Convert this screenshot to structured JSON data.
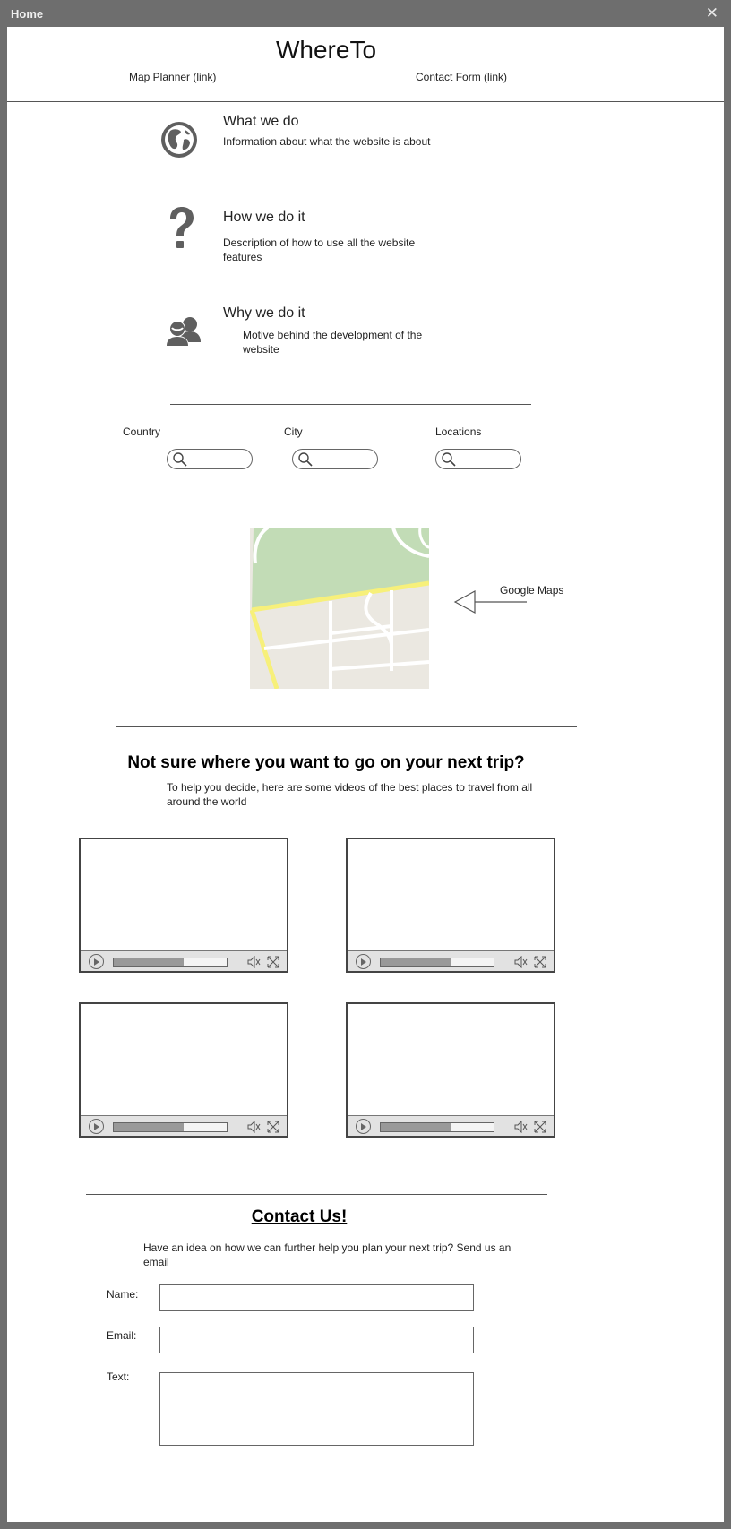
{
  "window": {
    "title": "Home",
    "close_glyph": "✕"
  },
  "header": {
    "brand": "WhereTo",
    "nav": [
      {
        "label": "Map Planner (link)"
      },
      {
        "label": "Contact Form (link)"
      }
    ]
  },
  "info": [
    {
      "icon": "globe-icon",
      "title": "What we do",
      "description": "Information about what the website is about"
    },
    {
      "icon": "question-icon",
      "title": "How we do it",
      "description": "Description of how to use all the website features"
    },
    {
      "icon": "people-icon",
      "title": "Why we do it",
      "description": "Motive behind the development of the website"
    }
  ],
  "filters": [
    {
      "label": "Country"
    },
    {
      "label": "City"
    },
    {
      "label": "Locations"
    }
  ],
  "map": {
    "label": "Google Maps"
  },
  "videos_section": {
    "heading": "Not sure where you want to go on your next trip?",
    "description": "To help you decide, here are some  videos of the best places to travel from all around the world",
    "videos": [
      {
        "progress": 0.62
      },
      {
        "progress": 0.62
      },
      {
        "progress": 0.62
      },
      {
        "progress": 0.62
      }
    ]
  },
  "contact": {
    "title": "Contact Us!",
    "description": "Have an idea on how we can further help you plan your next trip? Send us an email",
    "fields": {
      "name": {
        "label": "Name:"
      },
      "email": {
        "label": "Email:"
      },
      "text": {
        "label": "Text:"
      }
    }
  }
}
